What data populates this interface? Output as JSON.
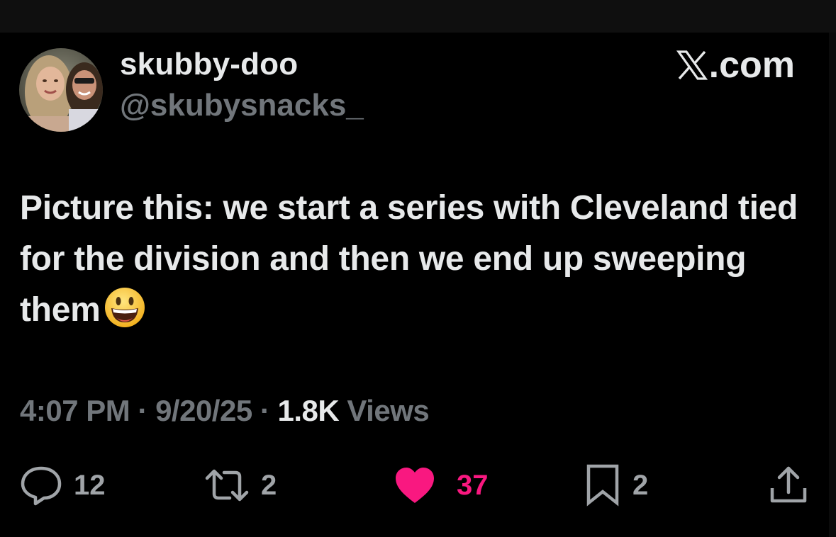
{
  "user": {
    "display_name": "skubby-doo",
    "handle": "@skubysnacks_"
  },
  "brand": {
    "text": ".com",
    "icon": "x-logo-icon"
  },
  "tweet": {
    "text": "Picture this: we start a series with Cleveland tied for the division and then we end up sweeping them",
    "emoji": "grinning-face-with-big-eyes"
  },
  "meta": {
    "time": "4:07 PM",
    "separator": " · ",
    "date": "9/20/25",
    "views_count": "1.8K",
    "views_label": " Views"
  },
  "actions": {
    "replies": "12",
    "reposts": "2",
    "likes": "37",
    "bookmarks": "2"
  },
  "colors": {
    "background": "#000000",
    "primary_text": "#e7e9ea",
    "secondary_text": "#71767b",
    "like_active": "#f91880"
  }
}
